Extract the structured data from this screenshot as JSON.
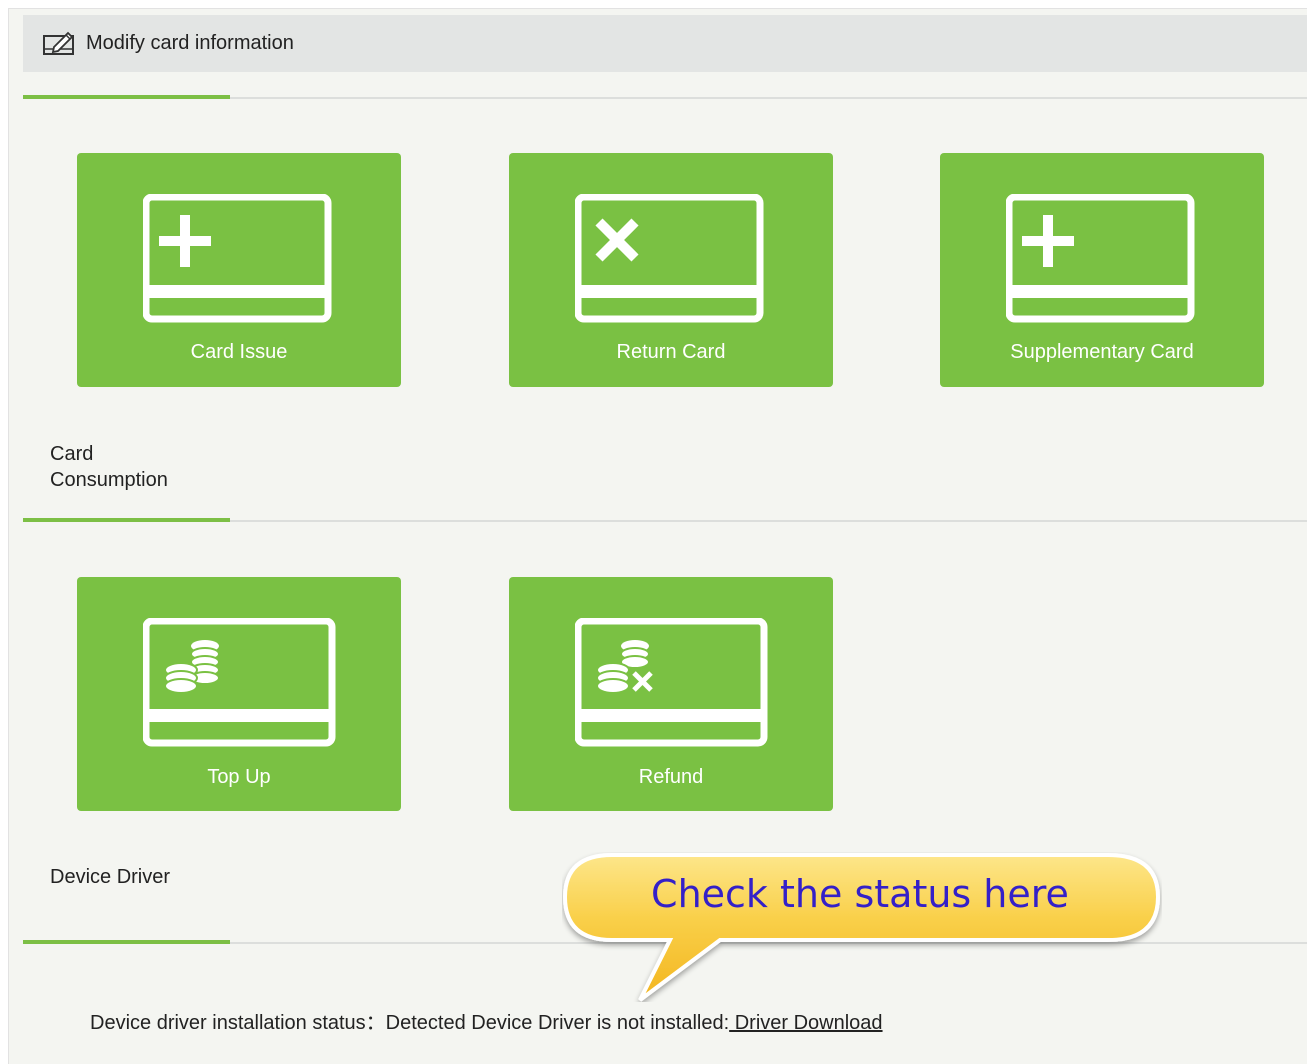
{
  "header": {
    "title": "Modify card information",
    "icon": "edit-card-icon"
  },
  "card_section": {
    "tiles": [
      {
        "label": "Card Issue",
        "icon": "card-plus-icon"
      },
      {
        "label": "Return Card",
        "icon": "card-x-icon"
      },
      {
        "label": "Supplementary Card",
        "icon": "card-plus-icon"
      }
    ]
  },
  "consumption_section": {
    "label_line1": "Card",
    "label_line2": "Consumption",
    "tiles": [
      {
        "label": "Top Up",
        "icon": "coins-icon"
      },
      {
        "label": "Refund",
        "icon": "coins-x-icon"
      }
    ]
  },
  "driver_section": {
    "label": "Device Driver",
    "status_prefix": "Device driver installation status：Detected Device Driver is not installed:",
    "download_link": " Driver Download"
  },
  "callout": {
    "text": "Check the status here"
  },
  "colors": {
    "tile_green": "#7ac143",
    "accent_green": "#7cbf45",
    "header_bg": "#e3e5e4",
    "callout_yellow": "#f7c02a",
    "callout_text": "#3420c8"
  }
}
